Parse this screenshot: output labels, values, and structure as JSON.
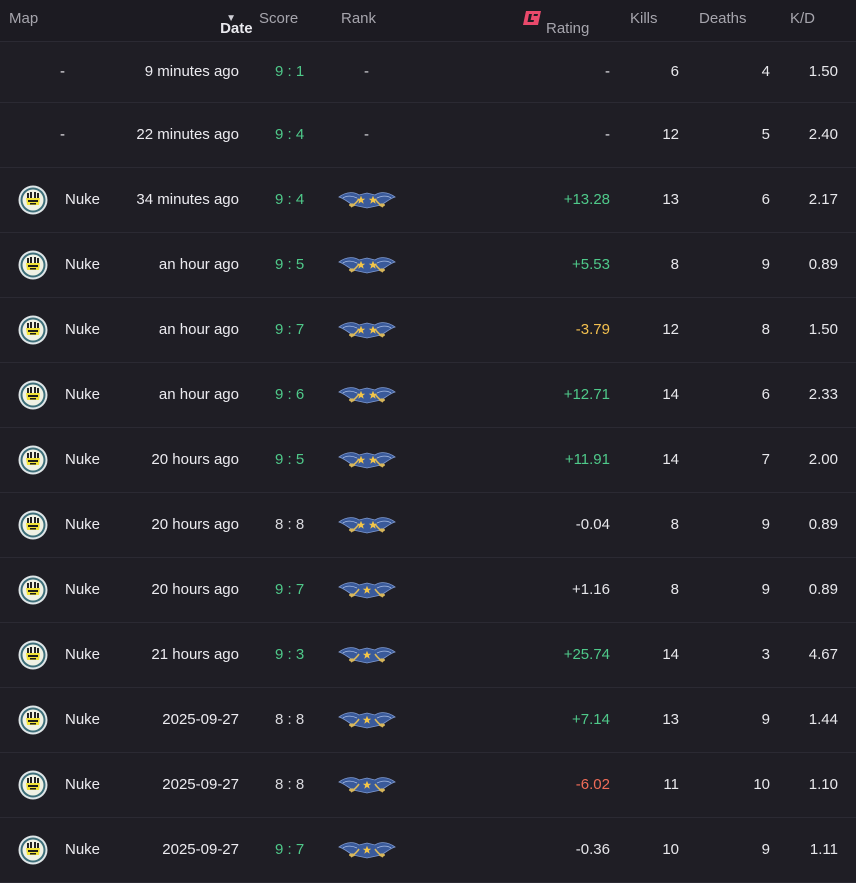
{
  "header": {
    "map": "Map",
    "date": "Date",
    "score": "Score",
    "rank": "Rank",
    "rating": "Rating",
    "kills": "Kills",
    "deaths": "Deaths",
    "kd": "K/D"
  },
  "colors": {
    "background": "#1c1b22",
    "win": "#4fc98a",
    "loss_rating": "#f06c58",
    "warn_rating": "#f3c04f",
    "rating_logo": "#e8496b"
  },
  "matches": [
    {
      "map": "-",
      "date": "9 minutes ago",
      "score": "9 : 1",
      "rank": "-",
      "rating": "-",
      "kills": "6",
      "deaths": "4",
      "kd": "1.50"
    },
    {
      "map": "-",
      "date": "22 minutes ago",
      "score": "9 : 4",
      "rank": "-",
      "rating": "-",
      "kills": "12",
      "deaths": "5",
      "kd": "2.40"
    },
    {
      "map": "Nuke",
      "date": "34 minutes ago",
      "score": "9 : 4",
      "rank": "gold-nova-2-icon",
      "rating": "+13.28",
      "kills": "13",
      "deaths": "6",
      "kd": "2.17"
    },
    {
      "map": "Nuke",
      "date": "an hour ago",
      "score": "9 : 5",
      "rank": "gold-nova-2-icon",
      "rating": "+5.53",
      "kills": "8",
      "deaths": "9",
      "kd": "0.89"
    },
    {
      "map": "Nuke",
      "date": "an hour ago",
      "score": "9 : 7",
      "rank": "gold-nova-2-icon",
      "rating": "-3.79",
      "kills": "12",
      "deaths": "8",
      "kd": "1.50"
    },
    {
      "map": "Nuke",
      "date": "an hour ago",
      "score": "9 : 6",
      "rank": "gold-nova-2-icon",
      "rating": "+12.71",
      "kills": "14",
      "deaths": "6",
      "kd": "2.33"
    },
    {
      "map": "Nuke",
      "date": "20 hours ago",
      "score": "9 : 5",
      "rank": "gold-nova-2-icon",
      "rating": "+11.91",
      "kills": "14",
      "deaths": "7",
      "kd": "2.00"
    },
    {
      "map": "Nuke",
      "date": "20 hours ago",
      "score": "8 : 8",
      "rank": "gold-nova-2-icon",
      "rating": "-0.04",
      "kills": "8",
      "deaths": "9",
      "kd": "0.89"
    },
    {
      "map": "Nuke",
      "date": "20 hours ago",
      "score": "9 : 7",
      "rank": "gold-nova-1-icon",
      "rating": "+1.16",
      "kills": "8",
      "deaths": "9",
      "kd": "0.89"
    },
    {
      "map": "Nuke",
      "date": "21 hours ago",
      "score": "9 : 3",
      "rank": "gold-nova-1-icon",
      "rating": "+25.74",
      "kills": "14",
      "deaths": "3",
      "kd": "4.67"
    },
    {
      "map": "Nuke",
      "date": "2025-09-27",
      "score": "8 : 8",
      "rank": "gold-nova-1-icon",
      "rating": "+7.14",
      "kills": "13",
      "deaths": "9",
      "kd": "1.44"
    },
    {
      "map": "Nuke",
      "date": "2025-09-27",
      "score": "8 : 8",
      "rank": "gold-nova-1-icon",
      "rating": "-6.02",
      "kills": "11",
      "deaths": "10",
      "kd": "1.10"
    },
    {
      "map": "Nuke",
      "date": "2025-09-27",
      "score": "9 : 7",
      "rank": "gold-nova-1-icon",
      "rating": "-0.36",
      "kills": "10",
      "deaths": "9",
      "kd": "1.11"
    }
  ]
}
